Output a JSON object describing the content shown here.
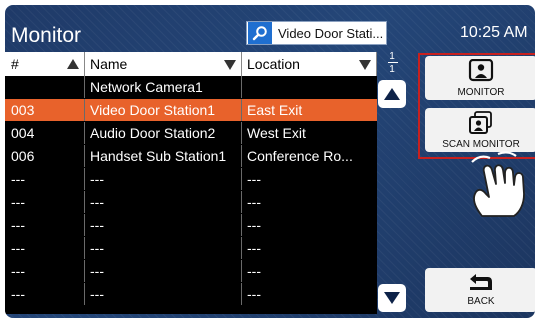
{
  "app": {
    "title": "Monitor",
    "time": "10:25 AM"
  },
  "search": {
    "value": "Video Door Stati..."
  },
  "table": {
    "headers": {
      "num": "#",
      "name": "Name",
      "location": "Location"
    },
    "rows": [
      {
        "num": "",
        "name": "Network Camera1",
        "location": ""
      },
      {
        "num": "003",
        "name": "Video Door Station1",
        "location": "East Exit"
      },
      {
        "num": "004",
        "name": "Audio Door Station2",
        "location": "West Exit"
      },
      {
        "num": "006",
        "name": "Handset Sub Station1",
        "location": "Conference Ro..."
      },
      {
        "num": "---",
        "name": "---",
        "location": "---"
      },
      {
        "num": "---",
        "name": "---",
        "location": "---"
      },
      {
        "num": "---",
        "name": "---",
        "location": "---"
      },
      {
        "num": "---",
        "name": "---",
        "location": "---"
      },
      {
        "num": "---",
        "name": "---",
        "location": "---"
      },
      {
        "num": "---",
        "name": "---",
        "location": "---"
      }
    ]
  },
  "pager": {
    "current": "1",
    "total": "1"
  },
  "buttons": {
    "monitor": "MONITOR",
    "scan_monitor": "SCAN MONITOR",
    "back": "BACK"
  },
  "colors": {
    "selected_row": "#e8622b",
    "background": "#1f3a68",
    "highlight_outline": "#c8201e"
  }
}
